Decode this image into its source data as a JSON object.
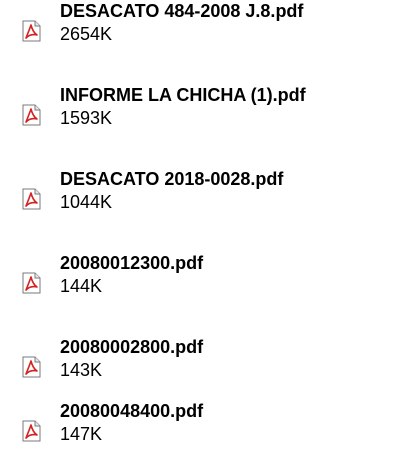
{
  "files": [
    {
      "name": "DESACATO 484-2008 J.8.pdf",
      "size": "2654K",
      "icon": "pdf-file-icon"
    },
    {
      "name": "INFORME LA CHICHA (1).pdf",
      "size": "1593K",
      "icon": "pdf-file-icon"
    },
    {
      "name": "DESACATO 2018-0028.pdf",
      "size": "1044K",
      "icon": "pdf-file-icon"
    },
    {
      "name": "20080012300.pdf",
      "size": "144K",
      "icon": "pdf-file-icon"
    },
    {
      "name": "20080002800.pdf",
      "size": "143K",
      "icon": "pdf-file-icon"
    },
    {
      "name": "20080048400.pdf",
      "size": "147K",
      "icon": "pdf-file-icon"
    }
  ],
  "colors": {
    "icon_accent": "#d42020",
    "text": "#000000"
  }
}
